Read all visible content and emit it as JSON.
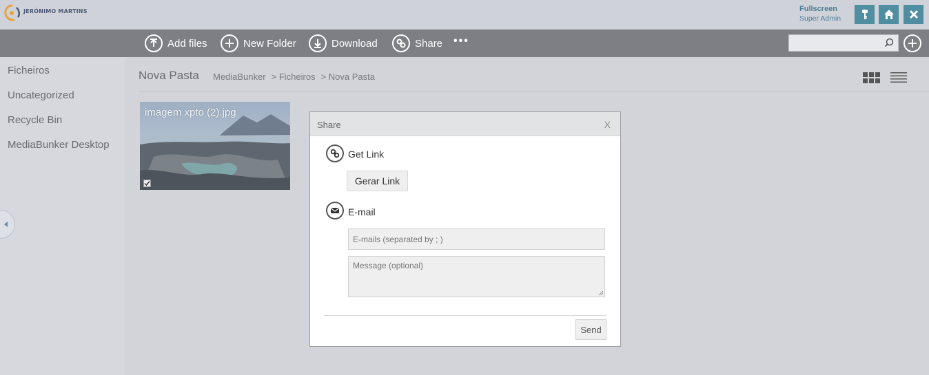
{
  "header": {
    "logo_text": "JERÓNIMO MARTINS",
    "fullscreen_label": "Fullscreen",
    "user_role": "Super Admin"
  },
  "toolbar": {
    "add_files": "Add files",
    "new_folder": "New Folder",
    "download": "Download",
    "share": "Share",
    "more": "•••",
    "search_placeholder": ""
  },
  "sidebar": {
    "items": [
      {
        "label": "Ficheiros"
      },
      {
        "label": "Uncategorized"
      },
      {
        "label": "Recycle Bin"
      },
      {
        "label": "MediaBunker Desktop"
      }
    ]
  },
  "main": {
    "title": "Nova Pasta",
    "breadcrumb": [
      "MediaBunker",
      "> Ficheiros",
      "> Nova Pasta"
    ],
    "files": [
      {
        "name": "imagem xpto (2).jpg",
        "checked": true
      }
    ]
  },
  "share_dialog": {
    "title": "Share",
    "close": "X",
    "get_link_label": "Get Link",
    "gerar_link_button": "Gerar Link",
    "email_label": "E-mail",
    "emails_placeholder": "E-mails (separated by ; )",
    "message_placeholder": "Message (optional)",
    "send_button": "Send"
  },
  "colors": {
    "accent": "#4f8da0",
    "toolbar_bg": "#7d7f84",
    "page_bg": "#d2d4da"
  }
}
